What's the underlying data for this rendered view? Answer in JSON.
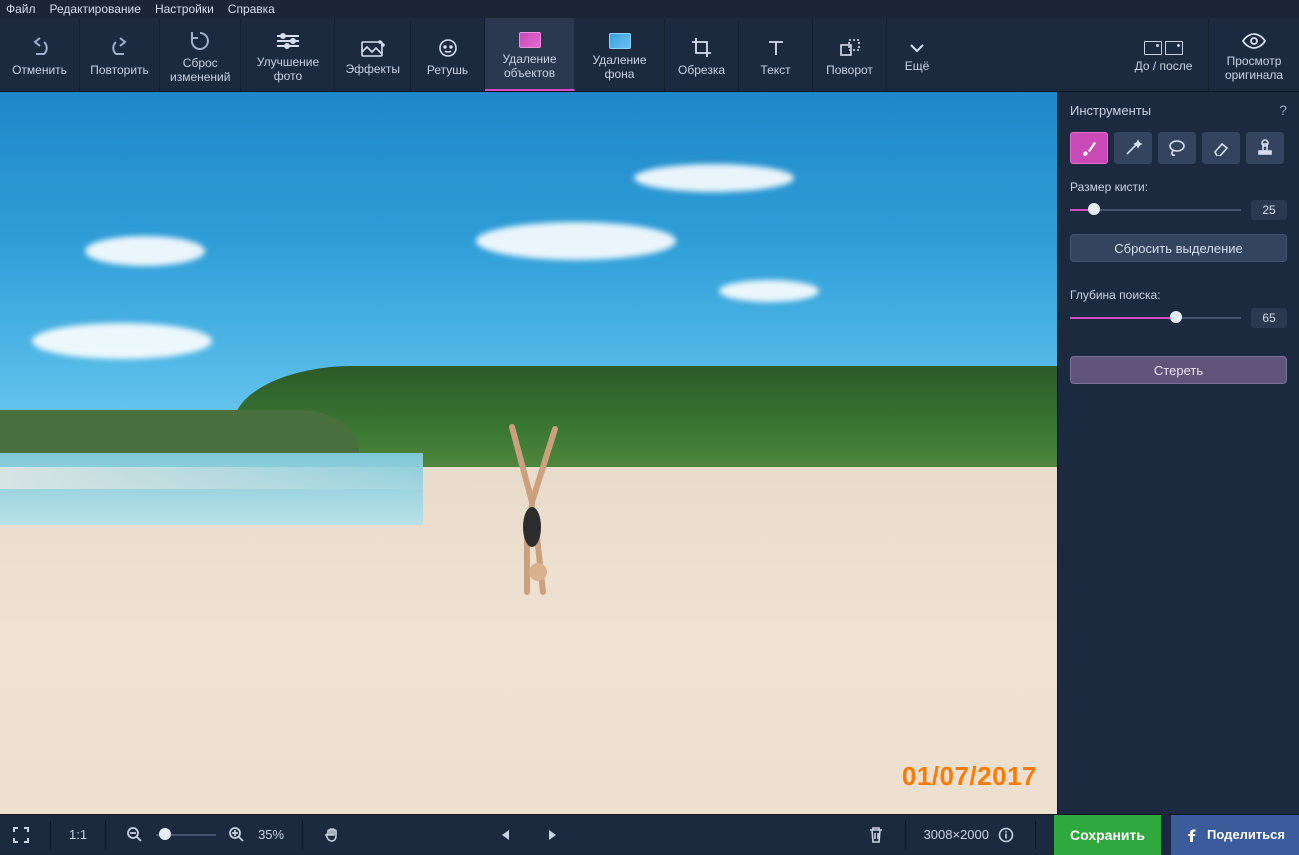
{
  "menubar": {
    "items": [
      "Файл",
      "Редактирование",
      "Настройки",
      "Справка"
    ]
  },
  "toolbar": {
    "undo": "Отменить",
    "redo": "Повторить",
    "reset": "Сброс\nизменений",
    "enhance": "Улучшение\nфото",
    "effects": "Эффекты",
    "retouch": "Ретушь",
    "remove_objects": "Удаление\nобъектов",
    "remove_bg": "Удаление\nфона",
    "crop": "Обрезка",
    "text": "Текст",
    "rotate": "Поворот",
    "more": "Ещё",
    "before_after": "До / после",
    "view_original": "Просмотр\nоригинала"
  },
  "canvas": {
    "date_stamp": "01/07/2017"
  },
  "sidebar": {
    "title": "Инструменты",
    "help": "?",
    "brush_label": "Размер кисти:",
    "brush_value": "25",
    "brush_percent": 14,
    "reset_selection": "Сбросить выделение",
    "depth_label": "Глубина поиска:",
    "depth_value": "65",
    "depth_percent": 62,
    "erase": "Стереть"
  },
  "bottombar": {
    "fit_label": "1:1",
    "zoom_label": "35%",
    "zoom_percent": 15,
    "dimensions": "3008×2000",
    "save": "Сохранить",
    "share": "Поделиться"
  }
}
